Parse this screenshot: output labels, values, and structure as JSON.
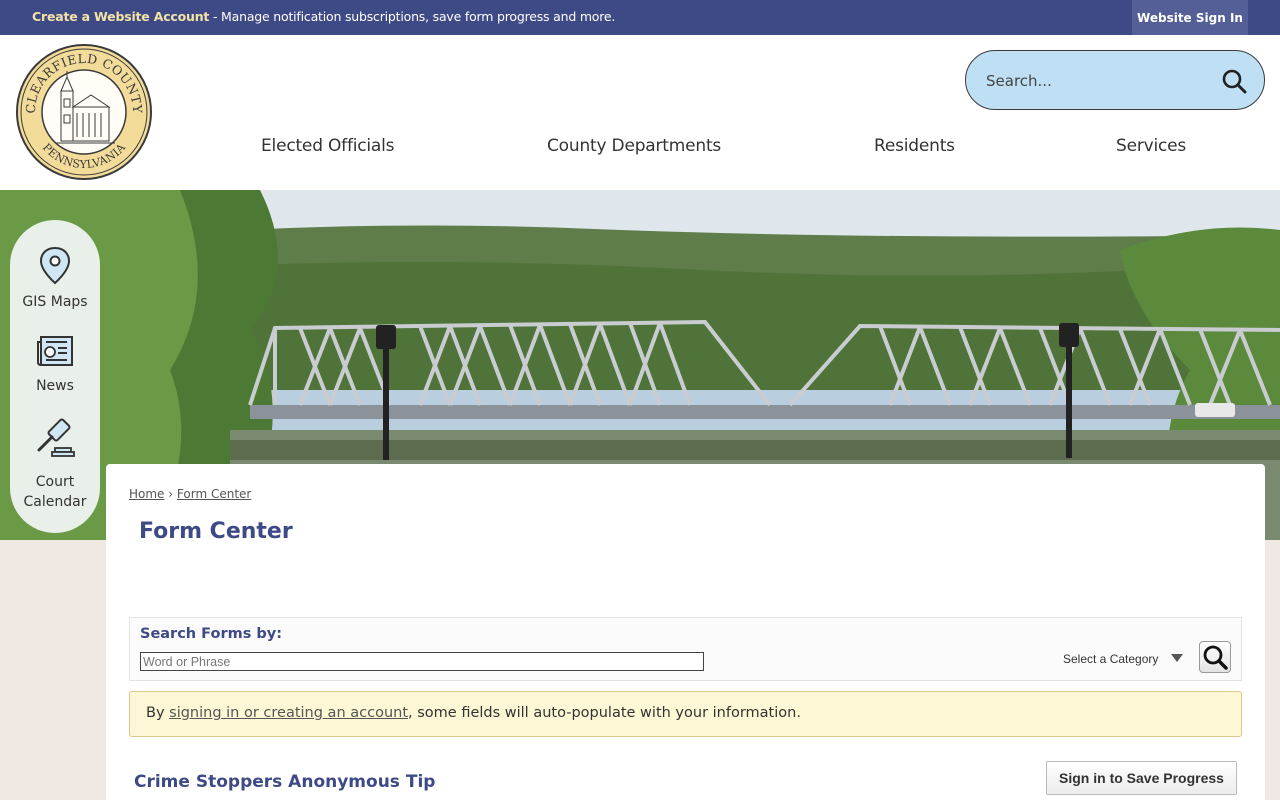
{
  "topbar": {
    "create_account_link": "Create a Website Account",
    "message": " - Manage notification subscriptions, save form progress and more.",
    "signin_label": "Website Sign In"
  },
  "header": {
    "logo": {
      "top_text": "CLEARFIELD COUNTY",
      "bottom_text": "PENNSYLVANIA"
    },
    "search": {
      "placeholder": "Search..."
    },
    "nav": [
      {
        "label": "Elected Officials"
      },
      {
        "label": "County Departments"
      },
      {
        "label": "Residents"
      },
      {
        "label": "Services"
      }
    ]
  },
  "quick_links": [
    {
      "label": "GIS Maps",
      "icon": "map-pin-icon"
    },
    {
      "label": "News",
      "icon": "newspaper-icon"
    },
    {
      "label_line1": "Court",
      "label_line2": "Calendar",
      "icon": "gavel-icon"
    }
  ],
  "breadcrumb": {
    "home": "Home",
    "separator": "›",
    "current": "Form Center"
  },
  "page_title": "Form Center",
  "search_forms": {
    "label": "Search Forms by:",
    "placeholder": "Word or Phrase",
    "category": "Select a Category"
  },
  "notice": {
    "prefix": "By ",
    "link": "signing in or creating an account",
    "suffix": ", some fields will auto-populate with your information."
  },
  "forms": [
    {
      "title": "Crime Stoppers Anonymous Tip",
      "save_label": "Sign in to Save Progress"
    }
  ],
  "colors": {
    "primary": "#3e4a86",
    "accent_yellow": "#f3e3a6",
    "search_bg": "#bfe0f4",
    "notice_bg": "#fdf7d5"
  }
}
